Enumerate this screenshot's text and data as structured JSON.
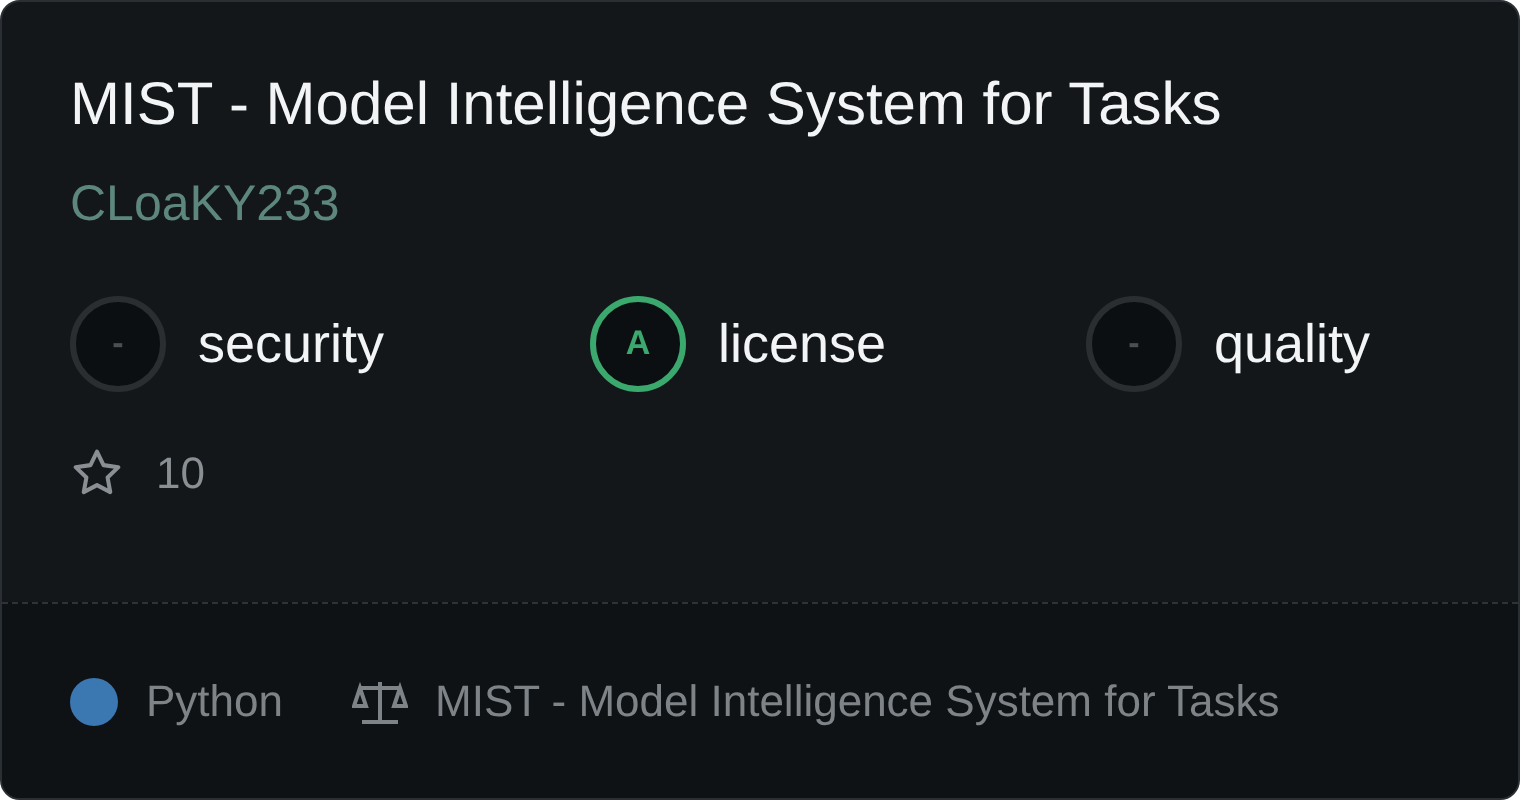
{
  "title": "MIST - Model Intelligence System for Tasks",
  "owner": "CLoaKY233",
  "scores": [
    {
      "grade": "-",
      "label": "security",
      "color": "#2a2e31"
    },
    {
      "grade": "A",
      "label": "license",
      "color": "#3ba86e"
    },
    {
      "grade": "-",
      "label": "quality",
      "color": "#2a2e31"
    }
  ],
  "stars": "10",
  "footer": {
    "language": {
      "name": "Python",
      "color": "#3b77b0"
    },
    "license": "MIST - Model Intelligence System for Tasks"
  }
}
